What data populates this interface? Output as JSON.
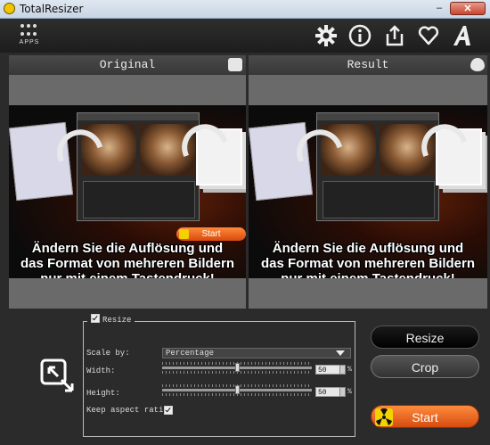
{
  "window": {
    "title": "TotalResizer",
    "minimize_glyph": "–",
    "close_glyph": "✕"
  },
  "toolbar": {
    "apps_label": "APPS",
    "icons": [
      "gear-icon",
      "info-icon",
      "share-icon",
      "heart-icon",
      "font-a-icon"
    ]
  },
  "panels": {
    "original": {
      "label": "Original",
      "icon": "layers-icon"
    },
    "result": {
      "label": "Result",
      "icon": "eye-icon"
    }
  },
  "preview": {
    "caption_lines": [
      "Ändern Sie die Auflösung und",
      "das Format von mehreren Bildern",
      "nur mit einem Tastendruck!"
    ],
    "start_label": "Start"
  },
  "settings": {
    "resize_checkbox_label": "Resize",
    "resize_checked": true,
    "scale_by_label": "Scale by:",
    "scale_by_value": "Percentage",
    "width_label": "Width:",
    "width_value": "50",
    "height_label": "Height:",
    "height_value": "50",
    "unit": "%",
    "keep_aspect_label": "Keep aspect ratio:",
    "keep_aspect_checked": true
  },
  "buttons": {
    "resize": "Resize",
    "crop": "Crop",
    "start": "Start"
  },
  "colors": {
    "accent_orange": "#e85d1a",
    "start_icon_yellow": "#f4d200"
  }
}
